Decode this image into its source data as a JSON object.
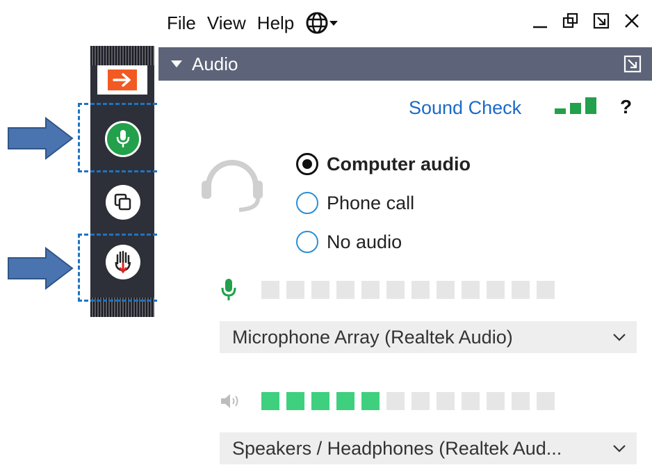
{
  "menu": {
    "items": [
      "File",
      "View",
      "Help"
    ],
    "language_icon": "globe-icon"
  },
  "window_controls": {
    "minimize_icon": "minimize-icon",
    "restore_icon": "restore-icon",
    "popout_icon": "popout-icon",
    "close_icon": "close-icon"
  },
  "panel": {
    "title": "Audio",
    "collapse_icon": "caret-down-icon",
    "popout_icon": "popout-icon"
  },
  "sound_check": {
    "label": "Sound Check",
    "signal_icon": "signal-bars-icon",
    "help_label": "?"
  },
  "audio_mode": {
    "options": [
      {
        "label": "Computer audio",
        "selected": true
      },
      {
        "label": "Phone call",
        "selected": false
      },
      {
        "label": "No audio",
        "selected": false
      }
    ],
    "headset_icon": "headset-icon"
  },
  "microphone": {
    "icon": "microphone-icon",
    "level_cells": 12,
    "level_on": 0,
    "device": "Microphone Array (Realtek Audio)"
  },
  "speakers": {
    "icon": "speaker-icon",
    "level_cells": 12,
    "level_on": 5,
    "device": "Speakers / Headphones (Realtek Aud..."
  },
  "toolbar": {
    "exit_icon": "arrow-right-icon",
    "mic_icon": "microphone-icon",
    "screen_share_icon": "screen-share-icon",
    "raise_hand_icon": "raise-hand-icon"
  },
  "colors": {
    "panel_header": "#5d6479",
    "link": "#1b6ac9",
    "level_on": "#3fd07f",
    "mic_green": "#22a04b",
    "toolbar_bg": "#2d3038",
    "exit_orange": "#f15a22",
    "highlight_blue": "#1f73c2"
  }
}
